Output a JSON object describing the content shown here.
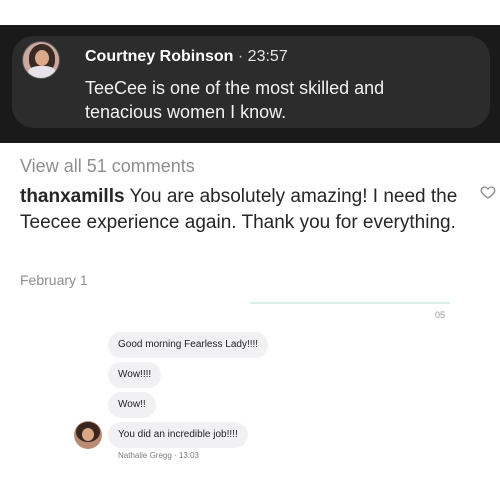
{
  "notification": {
    "sender": "Courtney Robinson",
    "separator": "·",
    "time": "23:57",
    "message": "TeeCee is one of the most skilled and tenacious women I know."
  },
  "comments": {
    "view_all": "View all 51 comments",
    "username": "thanxamills",
    "text": "You are absolutely amazing! I need the Teecee experience again. Thank you for everything.",
    "date": "February 1"
  },
  "chat": {
    "top_time": "05",
    "messages": [
      "Good morning Fearless Lady!!!!",
      "Wow!!!!",
      "Wow!!",
      "You did an incredible job!!!!"
    ],
    "sender_name": "Nathalie Gregg",
    "sender_sep": "·",
    "sender_time": "13:03"
  },
  "icons": {
    "heart": "heart-icon",
    "avatar": "avatar"
  },
  "colors": {
    "banner_bg": "#1a1a1a",
    "bubble_bg": "#f1f1f3",
    "muted_text": "#8e8e8e"
  }
}
